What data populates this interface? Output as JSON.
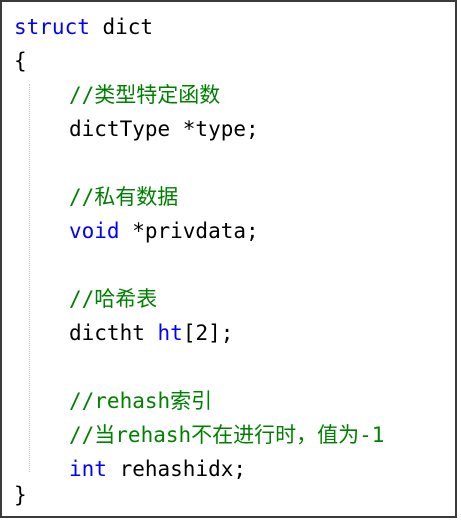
{
  "code": {
    "line1": {
      "keyword": "struct",
      "name": " dict"
    },
    "open_brace": "{",
    "comment_type": "//类型特定函数",
    "line_type": "dictType *type;",
    "comment_privdata": "//私有数据",
    "line_privdata": {
      "keyword": "void",
      "rest": " *privdata;"
    },
    "comment_ht": "//哈希表",
    "line_ht": {
      "type": "dictht ",
      "keyword": "ht",
      "rest": "[2];"
    },
    "comment_rehash1": "//rehash索引",
    "comment_rehash2": "//当rehash不在进行时，值为-1",
    "line_rehash": {
      "keyword": "int",
      "rest": " rehashidx;"
    },
    "close_brace": "}"
  },
  "colors": {
    "keyword": "#0000ff",
    "comment": "#008000",
    "text": "#000000",
    "border": "#3a3a3a"
  }
}
